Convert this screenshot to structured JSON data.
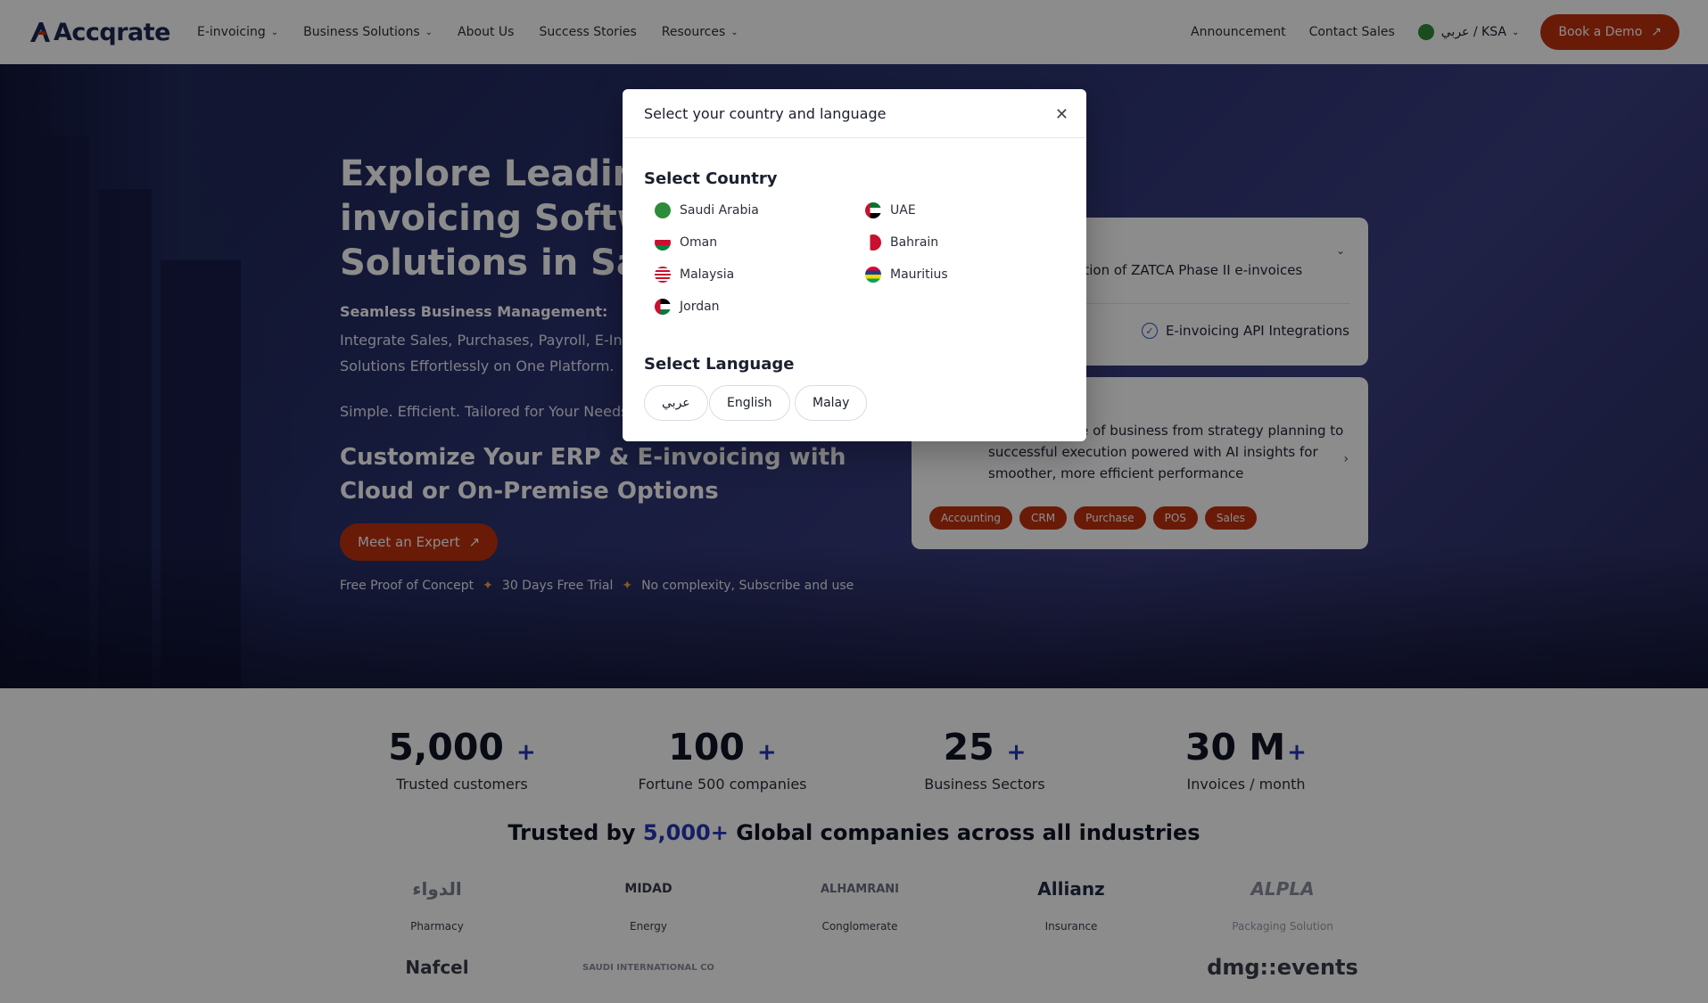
{
  "nav": {
    "logo_text": "Accqrate",
    "items": [
      {
        "label": "E-invoicing",
        "has_dropdown": true
      },
      {
        "label": "Business Solutions",
        "has_dropdown": true
      },
      {
        "label": "About Us",
        "has_dropdown": false
      },
      {
        "label": "Success Stories",
        "has_dropdown": false
      },
      {
        "label": "Resources",
        "has_dropdown": true
      }
    ],
    "right": {
      "announcement": "Announcement",
      "contact_sales": "Contact Sales",
      "lang_switch": "عربي / KSA",
      "book_demo": "Book a Demo"
    }
  },
  "hero": {
    "title": "Explore Leading ERP & E-invoicing Software Solutions in Saudi",
    "subhead": "Seamless Business Management:",
    "description": "Integrate Sales, Purchases, Payroll, E-Invoicing & Accounting Solutions Effortlessly on One Platform.",
    "tagline": "Simple. Efficient. Tailored for Your Needs.",
    "headline2": "Customize Your ERP & E-invoicing  with Cloud or On-Premise Options",
    "cta": "Meet an Expert",
    "perks": [
      "Free Proof of Concept",
      "30 Days Free Trial",
      "No complexity, Subscribe and use"
    ]
  },
  "cards": {
    "card1_line": "ration of ZATCA Phase II e-invoices",
    "card1_api": "E-invoicing API Integrations",
    "card2_text": "ge every stage of business from strategy planning to successful execution powered with AI insights for smoother, more efficient performance",
    "tags": [
      "Accounting",
      "CRM",
      "Purchase",
      "POS",
      "Sales"
    ]
  },
  "stats": [
    {
      "value": "5,000",
      "plus": "+",
      "label": "Trusted customers"
    },
    {
      "value": "100",
      "plus": "+",
      "label": "Fortune 500 companies"
    },
    {
      "value": "25",
      "plus": "+",
      "label": "Business Sectors"
    },
    {
      "value": "30 M",
      "plus": "+",
      "label": "Invoices / month"
    }
  ],
  "trusted": {
    "prefix": "Trusted by",
    "highlight": "5,000+",
    "suffix": "Global companies across all industries"
  },
  "logos": [
    {
      "name": "الدواء",
      "caption": "Pharmacy"
    },
    {
      "name": "MIDAD",
      "caption": "Energy"
    },
    {
      "name": "ALHAMRANI",
      "caption": "Conglomerate"
    },
    {
      "name": "Allianz",
      "caption": "Insurance"
    },
    {
      "name": "ALPLA",
      "caption": "Packaging Solution"
    }
  ],
  "logos_row2": [
    "Nafcel",
    "SAUDI INTERNATIONAL CO",
    "",
    "",
    "dmg::events"
  ],
  "modal": {
    "title": "Select your country and language",
    "country_heading": "Select Country",
    "countries": [
      {
        "name": "Saudi Arabia",
        "color": "#2e8b3a"
      },
      {
        "name": "UAE",
        "color": "#c8102e"
      },
      {
        "name": "Oman",
        "color": "#c8102e"
      },
      {
        "name": "Bahrain",
        "color": "#c8102e"
      },
      {
        "name": "Malaysia",
        "color": "#1a3d8f"
      },
      {
        "name": "Mauritius",
        "color": "#1a3d8f"
      },
      {
        "name": "Jordan",
        "color": "#1a1a1a"
      }
    ],
    "language_heading": "Select Language",
    "languages": [
      "عربي",
      "English",
      "Malay"
    ]
  },
  "colors": {
    "accent": "#c0320f",
    "brand_blue": "#2537b8",
    "overlay": "rgba(0,0,0,0.45)"
  }
}
